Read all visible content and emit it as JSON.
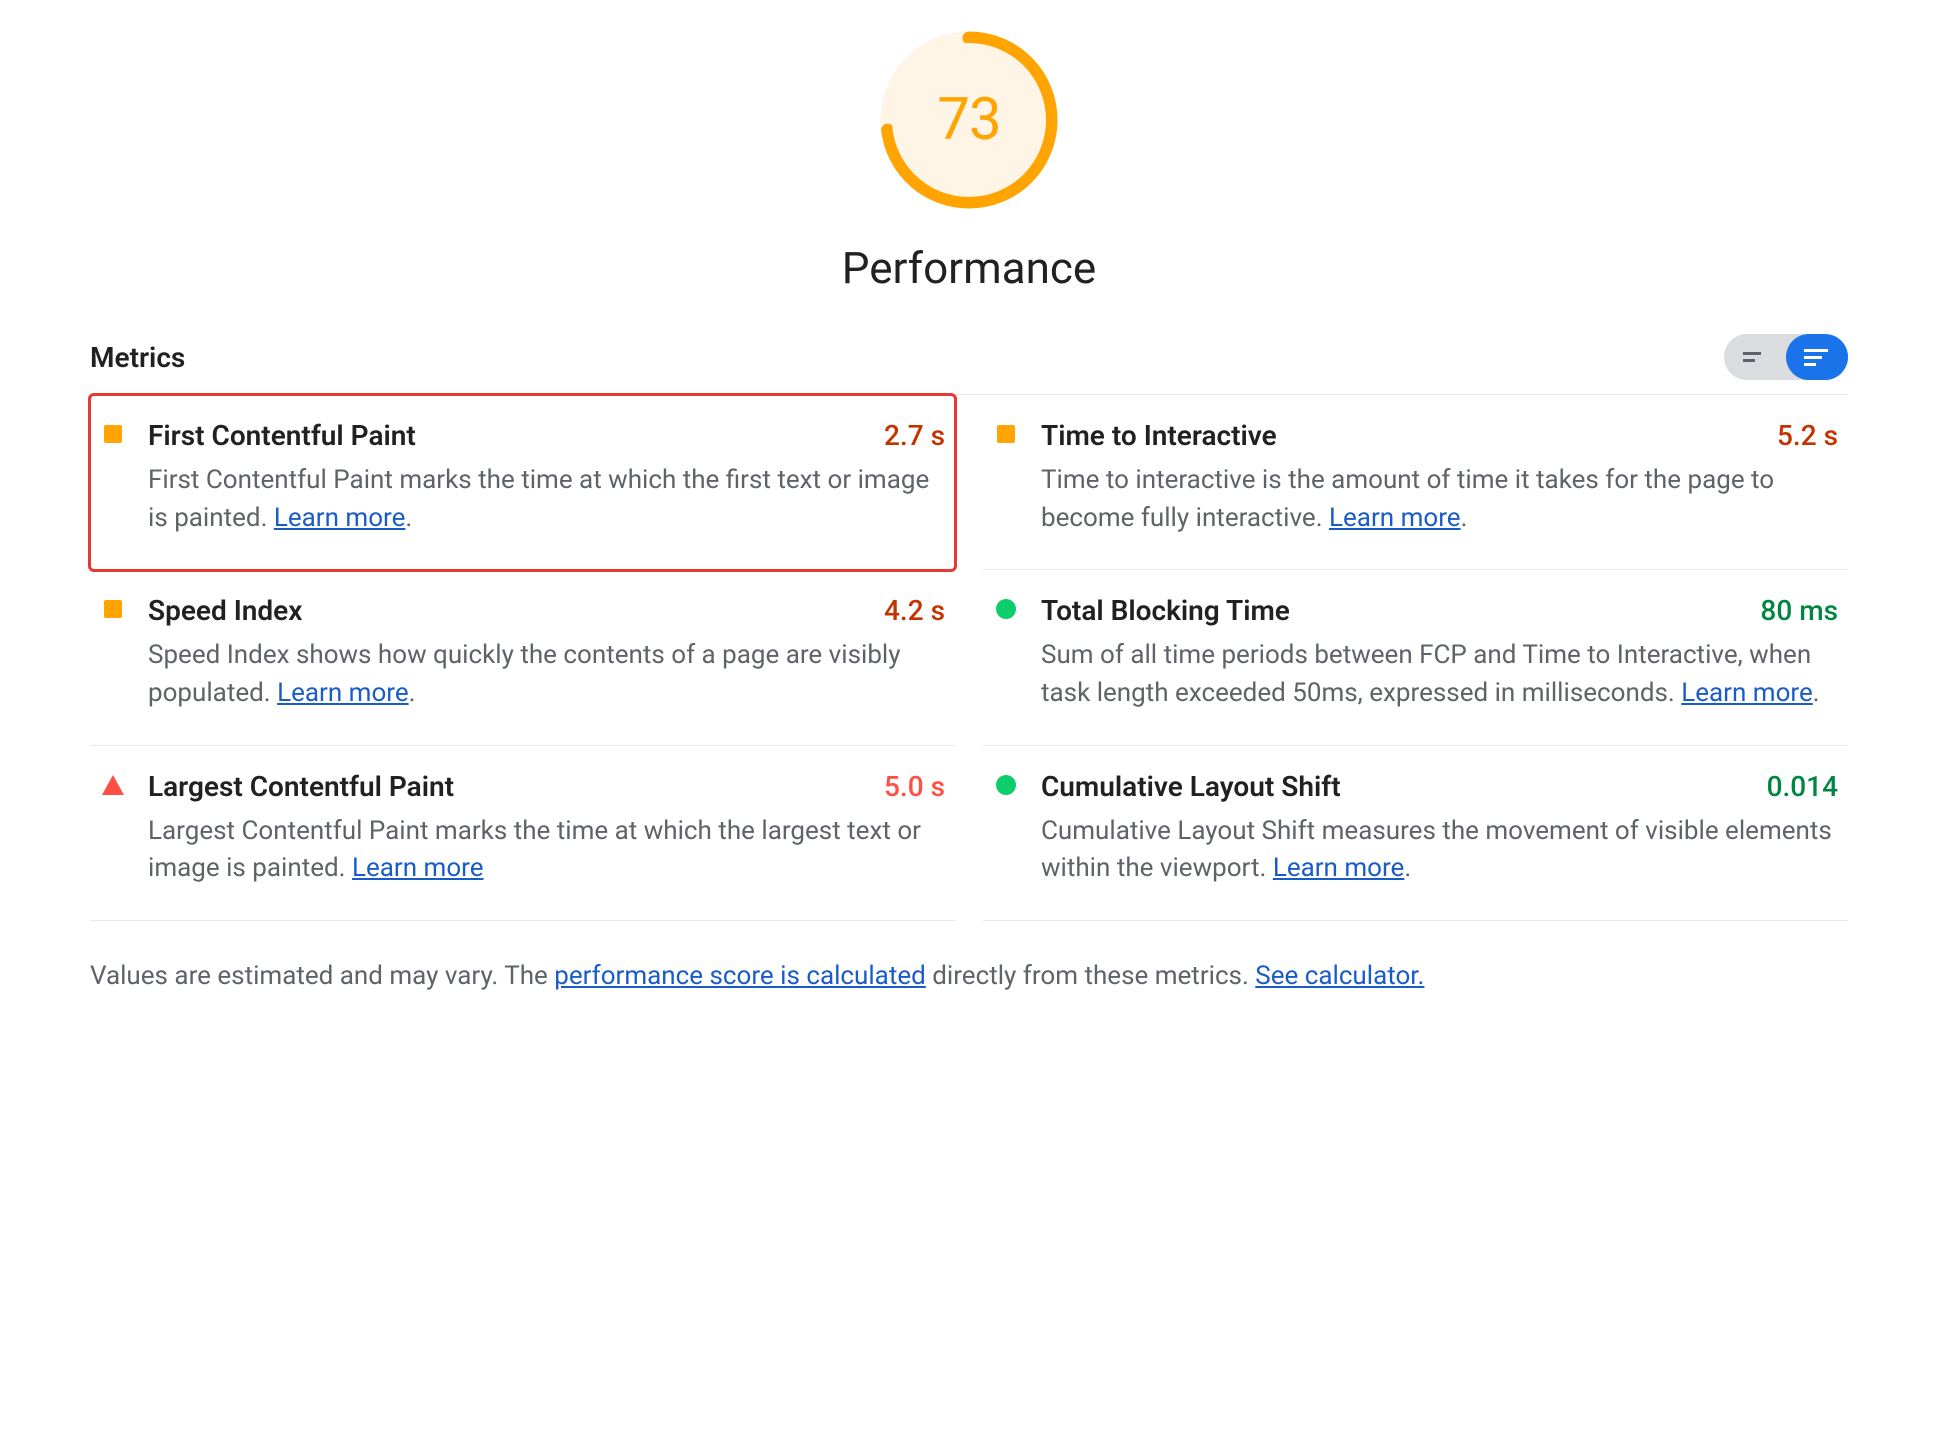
{
  "gauge": {
    "score": "73",
    "percent": 73,
    "color": "#FFA400",
    "title": "Performance"
  },
  "metrics_header": "Metrics",
  "toggle": {
    "compact_active": false,
    "expanded_active": true
  },
  "metrics": [
    {
      "status": "square",
      "title": "First Contentful Paint",
      "value": "2.7 s",
      "value_class": "val-orange",
      "desc": "First Contentful Paint marks the time at which the first text or image is painted. ",
      "link": "Learn more",
      "trailing": ".",
      "highlighted": true
    },
    {
      "status": "square",
      "title": "Time to Interactive",
      "value": "5.2 s",
      "value_class": "val-orange",
      "desc": "Time to interactive is the amount of time it takes for the page to become fully interactive. ",
      "link": "Learn more",
      "trailing": ".",
      "highlighted": false
    },
    {
      "status": "square",
      "title": "Speed Index",
      "value": "4.2 s",
      "value_class": "val-orange",
      "desc": "Speed Index shows how quickly the contents of a page are visibly populated. ",
      "link": "Learn more",
      "trailing": ".",
      "highlighted": false
    },
    {
      "status": "circle",
      "title": "Total Blocking Time",
      "value": "80 ms",
      "value_class": "val-green",
      "desc": "Sum of all time periods between FCP and Time to Interactive, when task length exceeded 50ms, expressed in milliseconds. ",
      "link": "Learn more",
      "trailing": ".",
      "highlighted": false
    },
    {
      "status": "triangle",
      "title": "Largest Contentful Paint",
      "value": "5.0 s",
      "value_class": "val-red",
      "desc": "Largest Contentful Paint marks the time at which the largest text or image is painted. ",
      "link": "Learn more",
      "trailing": "",
      "highlighted": false
    },
    {
      "status": "circle",
      "title": "Cumulative Layout Shift",
      "value": "0.014",
      "value_class": "val-green",
      "desc": "Cumulative Layout Shift measures the movement of visible elements within the viewport. ",
      "link": "Learn more",
      "trailing": ".",
      "highlighted": false
    }
  ],
  "footnote": {
    "pre": "Values are estimated and may vary. The ",
    "link1": "performance score is calculated",
    "mid": " directly from these metrics. ",
    "link2": "See calculator."
  }
}
